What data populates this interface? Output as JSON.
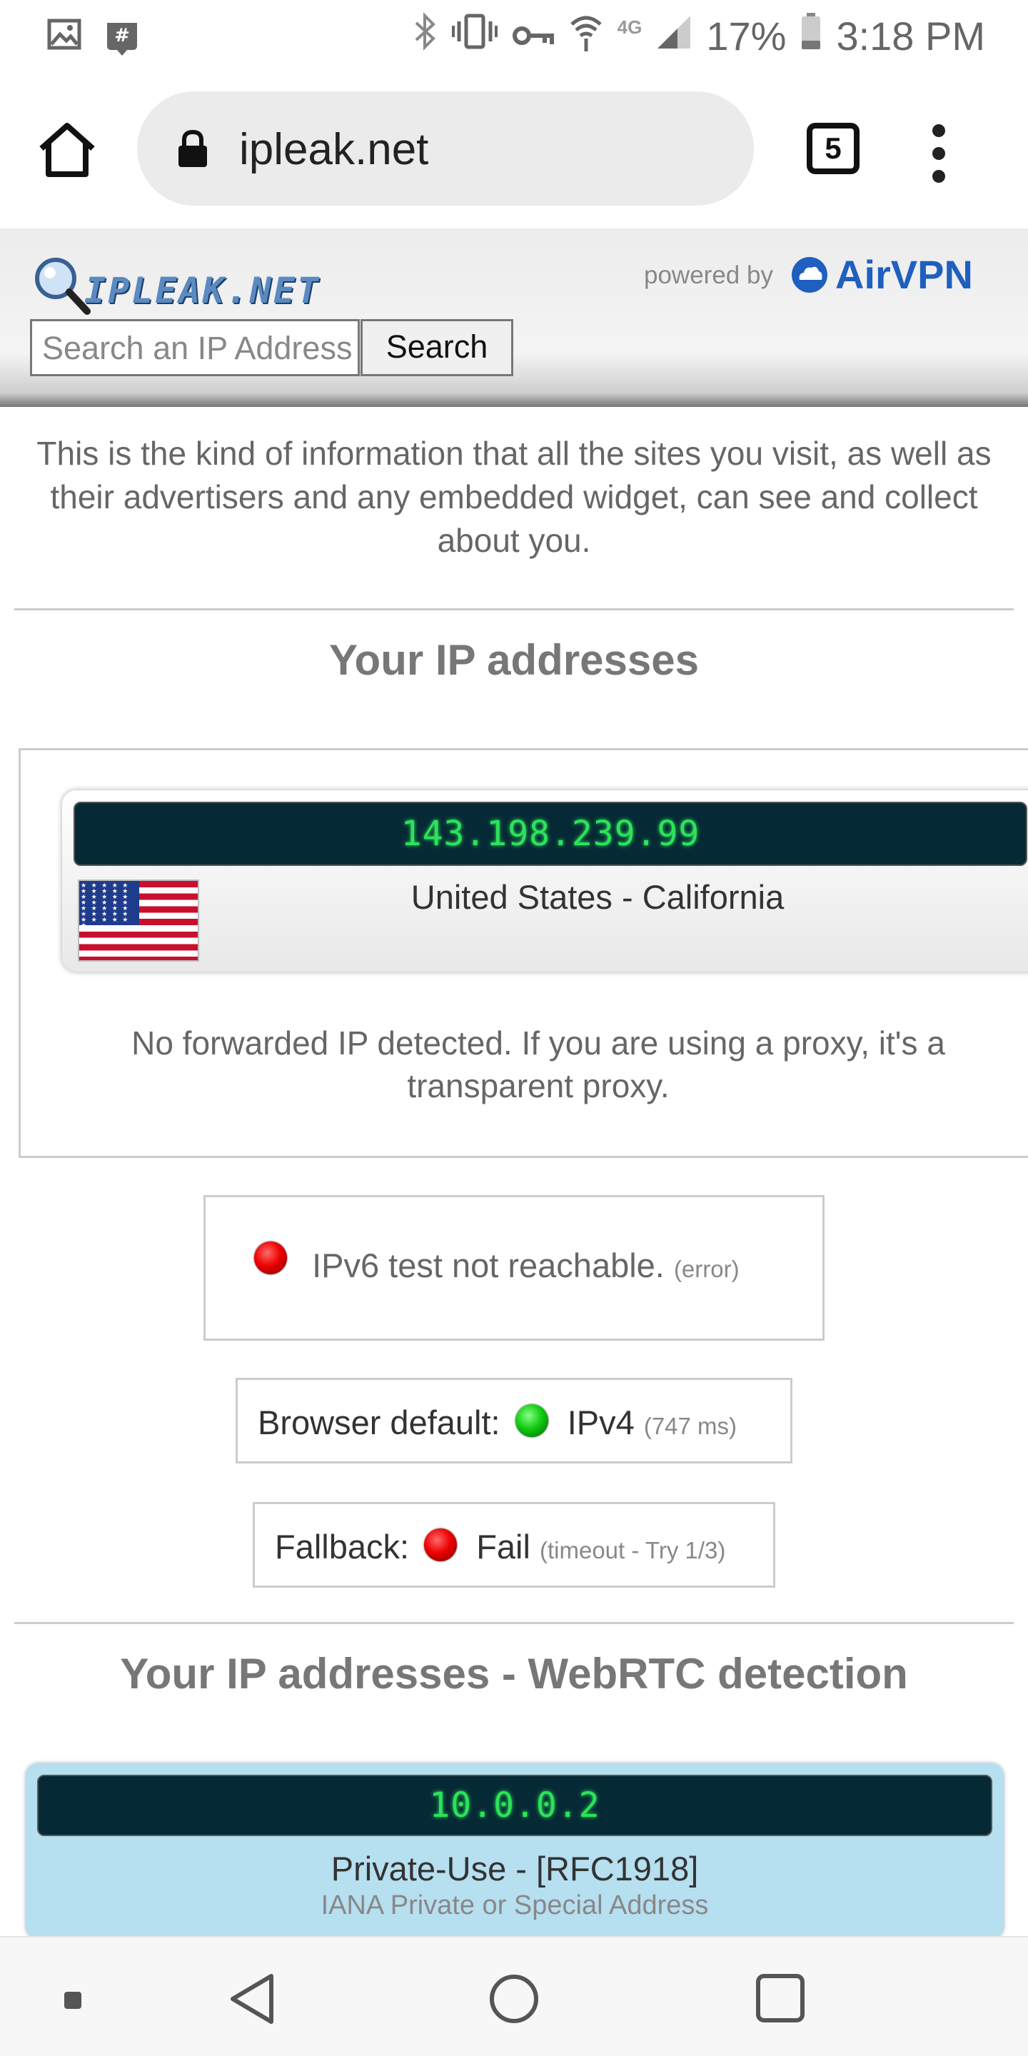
{
  "status_bar": {
    "battery_percent": "17%",
    "time": "3:18 PM",
    "network": "4G",
    "left_icons": [
      "gallery-icon",
      "groupme-icon"
    ],
    "right_icons": [
      "bluetooth-icon",
      "vibrate-icon",
      "vpn-key-icon",
      "wifi-icon",
      "signal-icon",
      "battery-icon"
    ]
  },
  "browser": {
    "url": "ipleak.net",
    "tab_count": "5"
  },
  "site_header": {
    "logo_text": "IPLEAK.NET",
    "powered_by": "powered by",
    "airvpn": "AirVPN",
    "search_placeholder": "Search an IP Address",
    "search_button": "Search"
  },
  "intro": "This is the kind of information that all the sites you visit, as well as their advertisers and any embedded widget, can see and collect about you.",
  "ip_section": {
    "title": "Your IP addresses",
    "ip": "143.198.239.99",
    "location": "United States - California",
    "forwarded": "No forwarded IP detected. If you are using a proxy, it's a transparent proxy."
  },
  "tests": {
    "ipv6_text": "IPv6 test not reachable.",
    "ipv6_note": "(error)",
    "browser_default_label": "Browser default:",
    "browser_default_value": "IPv4",
    "browser_default_note": "(747 ms)",
    "fallback_label": "Fallback:",
    "fallback_value": "Fail",
    "fallback_note": "(timeout - Try 1/3)"
  },
  "webrtc": {
    "title": "Your IP addresses - WebRTC detection",
    "ip": "10.0.0.2",
    "type": "Private-Use - [RFC1918]",
    "subtitle": "IANA Private or Special Address"
  },
  "colors": {
    "lcd_bg": "#062a35",
    "lcd_text": "#2de25a",
    "airvpn_blue": "#1f5fbf",
    "webrtc_bg": "#b6dff0"
  }
}
